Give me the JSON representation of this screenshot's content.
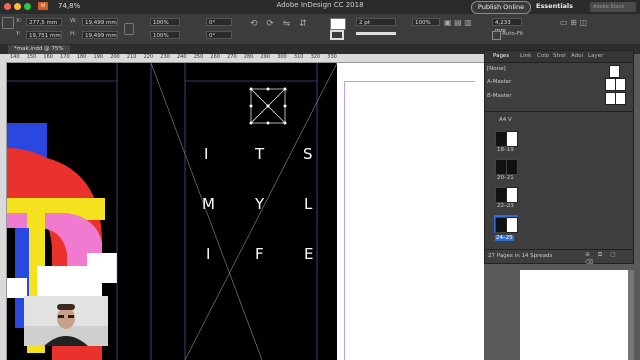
{
  "app": {
    "title": "Adobe InDesign CC 2018",
    "zoom": "74,8%",
    "publish_label": "Publish Online",
    "workspace": "Essentials",
    "search_placeholder": "Adobe Stock"
  },
  "control": {
    "x_label": "X:",
    "x_value": "277,5 mm",
    "y_label": "Y:",
    "y_value": "19,751 mm",
    "w_label": "W:",
    "w_value": "19,499 mm",
    "h_label": "H:",
    "h_value": "19,499 mm",
    "scale_x": "100%",
    "scale_y": "100%",
    "angle": "0°",
    "shear": "0°",
    "stroke_weight": "2 pt",
    "gap_value": "4,233 mm",
    "opacity": "100%",
    "autofit_label": "Auto-Fit"
  },
  "document": {
    "tab_label": "*mak.indd @ 75%"
  },
  "ruler": {
    "ticks": [
      "140",
      "150",
      "160",
      "170",
      "180",
      "190",
      "200",
      "210",
      "220",
      "230",
      "240",
      "250",
      "260",
      "270",
      "280",
      "290",
      "300",
      "310",
      "320",
      "330"
    ]
  },
  "artwork": {
    "letters_row1": [
      "I",
      "T",
      "S"
    ],
    "letters_row2": [
      "M",
      "Y",
      "L"
    ],
    "letters_row3": [
      "I",
      "F",
      "E"
    ]
  },
  "pages_panel": {
    "tabs": [
      "Pages",
      "Link",
      "Colo",
      "Strol",
      "Adol",
      "Layer"
    ],
    "none_label": "[None]",
    "masters": [
      "A-Master",
      "B-Master"
    ],
    "size_select": "A4 V",
    "spreads": [
      "18–19",
      "20–21",
      "22–23",
      "24–25"
    ],
    "status": "27 Pages in 14 Spreads"
  },
  "colors": {
    "accent_blue": "#2f6fd6",
    "art_red": "#e8322b",
    "art_yellow": "#f5e21e",
    "art_pink": "#f07ad0",
    "art_blue": "#2a48e0"
  }
}
